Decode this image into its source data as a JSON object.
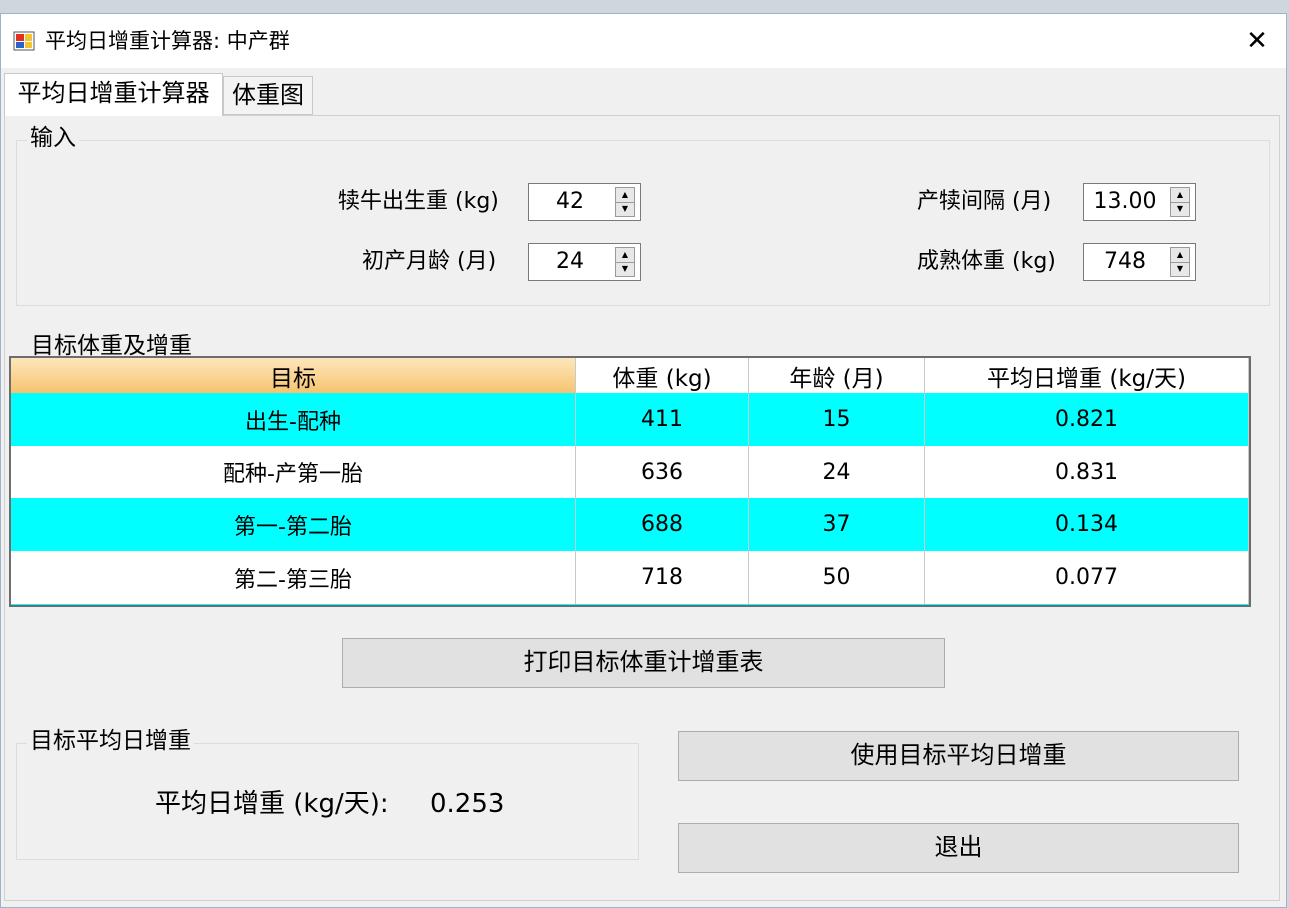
{
  "window": {
    "title": "平均日增重计算器: 中产群",
    "close_glyph": "✕"
  },
  "tabs": [
    {
      "label": "平均日增重计算器",
      "active": true
    },
    {
      "label": "体重图",
      "active": false
    }
  ],
  "input_group": {
    "legend": "输入",
    "birth_weight": {
      "label": "犊牛出生重 (kg)",
      "value": "42"
    },
    "first_calving_age": {
      "label": "初产月龄 (月)",
      "value": "24"
    },
    "calving_interval": {
      "label": "产犊间隔 (月)",
      "value": "13.00"
    },
    "mature_weight": {
      "label": "成熟体重 (kg)",
      "value": "748"
    }
  },
  "target_group": {
    "legend": "目标体重及增重",
    "columns": [
      "目标",
      "体重 (kg)",
      "年龄 (月)",
      "平均日增重 (kg/天)"
    ],
    "rows": [
      [
        "出生-配种",
        "411",
        "15",
        "0.821"
      ],
      [
        "配种-产第一胎",
        "636",
        "24",
        "0.831"
      ],
      [
        "第一-第二胎",
        "688",
        "37",
        "0.134"
      ],
      [
        "第二-第三胎",
        "718",
        "50",
        "0.077"
      ]
    ],
    "row_colors": [
      "#00ffff",
      "#ffffff",
      "#00ffff",
      "#ffffff"
    ]
  },
  "print_button": "打印目标体重计增重表",
  "adg_group": {
    "legend": "目标平均日增重",
    "label": "平均日增重 (kg/天):",
    "value": "0.253"
  },
  "use_button": "使用目标平均日增重",
  "exit_button": "退出",
  "colors": {
    "highlight_row": "#00ffff",
    "header_selected": "#f6c36f"
  }
}
